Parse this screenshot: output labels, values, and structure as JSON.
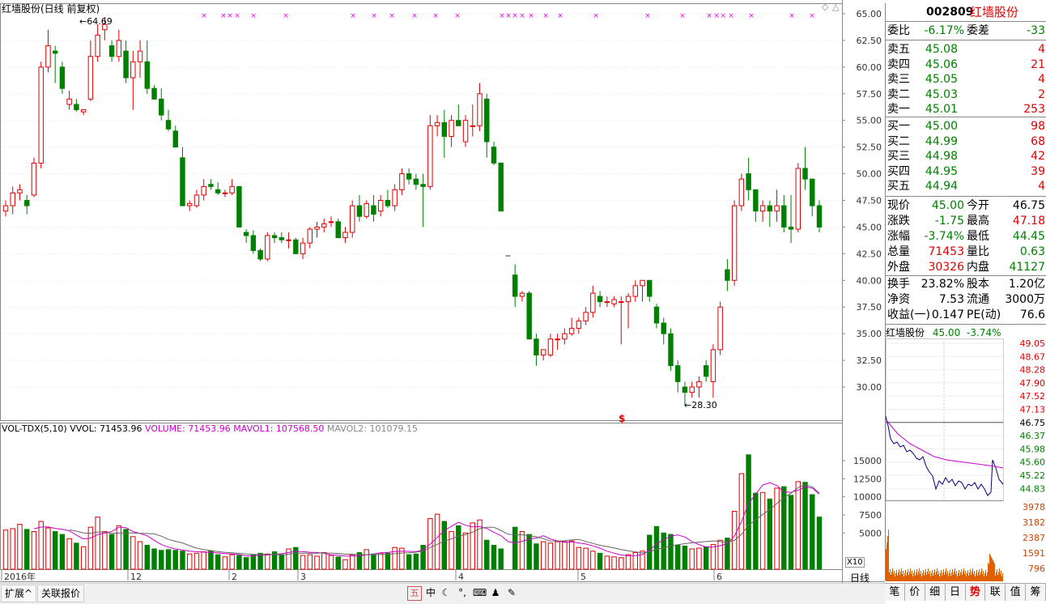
{
  "main_chart": {
    "title": "红墙股份(日线 前复权)",
    "high_marker": "64.69",
    "low_marker": "28.30",
    "y_ticks": [
      "65.00",
      "62.50",
      "60.00",
      "57.50",
      "55.00",
      "52.50",
      "50.00",
      "47.50",
      "45.00",
      "42.50",
      "40.00",
      "37.50",
      "35.00",
      "32.50",
      "30.00"
    ],
    "period_button": "日线"
  },
  "volume_chart": {
    "legend_name": "VOL-TDX(5,10)",
    "vvol": "VVOL: 71453.96",
    "volume": "VOLUME: 71453.96",
    "mavol1": "MAVOL1: 107568.50",
    "mavol2": "MAVOL2: 101079.15",
    "y_ticks": [
      "15000",
      "12500",
      "10000",
      "7500",
      "5000"
    ],
    "scale_label": "X10"
  },
  "x_axis": {
    "labels": [
      "2016年",
      "12",
      "2",
      "3",
      "4",
      "5",
      "6"
    ]
  },
  "quote": {
    "code": "002809",
    "name": "红墙股份",
    "weibi_label": "委比",
    "weibi": "-6.17%",
    "weicha_label": "委差",
    "weicha": "-33",
    "asks": [
      {
        "label": "卖五",
        "price": "45.08",
        "vol": "4"
      },
      {
        "label": "卖四",
        "price": "45.06",
        "vol": "21"
      },
      {
        "label": "卖三",
        "price": "45.05",
        "vol": "4"
      },
      {
        "label": "卖二",
        "price": "45.03",
        "vol": "2"
      },
      {
        "label": "卖一",
        "price": "45.01",
        "vol": "253"
      }
    ],
    "bids": [
      {
        "label": "买一",
        "price": "45.00",
        "vol": "98"
      },
      {
        "label": "买二",
        "price": "44.99",
        "vol": "68"
      },
      {
        "label": "买三",
        "price": "44.98",
        "vol": "42"
      },
      {
        "label": "买四",
        "price": "44.95",
        "vol": "39"
      },
      {
        "label": "买五",
        "price": "44.94",
        "vol": "4"
      }
    ],
    "stats": [
      {
        "l1": "现价",
        "v1": "45.00",
        "c1": "green",
        "l2": "今开",
        "v2": "46.75",
        "c2": "blk"
      },
      {
        "l1": "涨跌",
        "v1": "-1.75",
        "c1": "green",
        "l2": "最高",
        "v2": "47.18",
        "c2": "red"
      },
      {
        "l1": "涨幅",
        "v1": "-3.74%",
        "c1": "green",
        "l2": "最低",
        "v2": "44.45",
        "c2": "green"
      },
      {
        "l1": "总量",
        "v1": "71453",
        "c1": "red",
        "l2": "量比",
        "v2": "0.63",
        "c2": "green"
      },
      {
        "l1": "外盘",
        "v1": "30326",
        "c1": "red",
        "l2": "内盘",
        "v2": "41127",
        "c2": "green"
      }
    ],
    "stats2": [
      {
        "l1": "换手",
        "v1": "23.82%",
        "l2": "股本",
        "v2": "1.20亿"
      },
      {
        "l1": "净资",
        "v1": "7.53",
        "l2": "流通",
        "v2": "3000万"
      },
      {
        "l1": "收益(一)",
        "v1": "0.147",
        "l2": "PE(动)",
        "v2": "76.6"
      }
    ]
  },
  "mini_chart": {
    "title": "红墙股份",
    "price": "45.00",
    "pct": "-3.74%",
    "price_ticks": [
      "49.05",
      "48.67",
      "48.28",
      "47.90",
      "47.52",
      "47.13",
      "46.75",
      "46.37",
      "45.98",
      "45.60",
      "45.22",
      "44.83"
    ],
    "vol_ticks": [
      "3978",
      "3182",
      "2387",
      "1591",
      "796"
    ]
  },
  "bottom_tabs": [
    "笔",
    "价",
    "细",
    "日",
    "势",
    "联",
    "值",
    "筹"
  ],
  "active_tab": "势",
  "bottom_bar": {
    "expand_btn": "扩展^",
    "related_btn": "关联报价",
    "tools": [
      "五",
      "中"
    ]
  },
  "colors": {
    "up": "#e00000",
    "down": "#008000",
    "ma1": "#cc00cc",
    "ma2": "#666666",
    "mark": "#ff00ff"
  },
  "chart_data": {
    "type": "candlestick",
    "ylim": [
      27,
      66
    ],
    "candles": [
      [
        46.5,
        47.5,
        46.0,
        47.0
      ],
      [
        47.0,
        48.8,
        46.2,
        48.2
      ],
      [
        48.2,
        49.0,
        47.5,
        48.5
      ],
      [
        47.5,
        48.0,
        46.2,
        47.0
      ],
      [
        48.0,
        51.5,
        47.8,
        51.0
      ],
      [
        51.0,
        60.5,
        50.5,
        60.0
      ],
      [
        60.0,
        63.5,
        59.5,
        62.0
      ],
      [
        61.5,
        62.0,
        58.5,
        61.3
      ],
      [
        60.0,
        60.5,
        57.5,
        58.0
      ],
      [
        56.5,
        57.8,
        56.0,
        57.0
      ],
      [
        56.5,
        57.0,
        55.8,
        56.0
      ],
      [
        55.8,
        56.0,
        55.5,
        56.0
      ],
      [
        57.0,
        62.5,
        56.8,
        61.0
      ],
      [
        61.0,
        64.0,
        60.5,
        63.0
      ],
      [
        63.5,
        64.69,
        62.5,
        64.0
      ],
      [
        62.0,
        62.5,
        60.5,
        61.0
      ],
      [
        61.0,
        63.5,
        60.5,
        62.5
      ],
      [
        61.5,
        62.5,
        58.5,
        59.0
      ],
      [
        59.0,
        61.5,
        56.0,
        60.5
      ],
      [
        60.5,
        62.5,
        59.0,
        61.5
      ],
      [
        60.5,
        62.5,
        57.5,
        58.0
      ],
      [
        58.0,
        58.3,
        57.5,
        57.0
      ],
      [
        57.0,
        58.0,
        55.0,
        55.5
      ],
      [
        55.0,
        56.0,
        54.0,
        54.2
      ],
      [
        54.0,
        54.5,
        52.5,
        52.5
      ],
      [
        51.5,
        52.5,
        47.0,
        47.0
      ],
      [
        47.0,
        47.5,
        46.5,
        47.2
      ],
      [
        47.0,
        48.5,
        46.8,
        48.0
      ],
      [
        48.0,
        49.5,
        47.5,
        48.8
      ],
      [
        49.0,
        49.5,
        48.5,
        48.8
      ],
      [
        48.5,
        49.2,
        48.0,
        48.2
      ],
      [
        48.2,
        48.5,
        47.8,
        48.2
      ],
      [
        48.2,
        49.5,
        48.0,
        48.8
      ],
      [
        48.8,
        48.8,
        45.0,
        45.0
      ],
      [
        44.5,
        44.8,
        43.5,
        44.2
      ],
      [
        44.2,
        44.7,
        42.5,
        42.8
      ],
      [
        42.8,
        43.0,
        41.8,
        42.0
      ],
      [
        42.0,
        44.5,
        41.8,
        44.2
      ],
      [
        44.2,
        44.5,
        43.5,
        44.0
      ],
      [
        44.0,
        44.5,
        43.5,
        43.8
      ],
      [
        43.8,
        44.5,
        43.0,
        43.8
      ],
      [
        43.8,
        44.0,
        42.5,
        42.5
      ],
      [
        42.5,
        44.0,
        42.0,
        43.5
      ],
      [
        43.5,
        45.0,
        43.0,
        44.8
      ],
      [
        44.8,
        45.5,
        44.0,
        45.0
      ],
      [
        45.0,
        45.8,
        44.5,
        45.3
      ],
      [
        45.5,
        46.0,
        45.0,
        45.5
      ],
      [
        45.5,
        45.8,
        44.0,
        44.0
      ],
      [
        44.0,
        45.0,
        43.5,
        44.5
      ],
      [
        44.5,
        47.5,
        44.0,
        47.0
      ],
      [
        47.0,
        48.0,
        45.5,
        46.0
      ],
      [
        46.0,
        47.5,
        45.8,
        47.2
      ],
      [
        47.0,
        48.0,
        45.5,
        46.2
      ],
      [
        46.5,
        48.0,
        46.0,
        47.5
      ],
      [
        47.5,
        48.5,
        46.8,
        47.0
      ],
      [
        47.0,
        49.0,
        46.5,
        48.5
      ],
      [
        48.5,
        50.5,
        48.0,
        50.0
      ],
      [
        50.0,
        50.5,
        49.0,
        49.5
      ],
      [
        49.5,
        50.0,
        48.5,
        49.0
      ],
      [
        49.0,
        50.0,
        45.0,
        48.8
      ],
      [
        48.8,
        55.5,
        48.5,
        54.5
      ],
      [
        54.5,
        55.5,
        53.5,
        54.8
      ],
      [
        54.8,
        56.0,
        51.5,
        53.5
      ],
      [
        53.5,
        55.5,
        52.5,
        55.0
      ],
      [
        55.0,
        56.5,
        54.5,
        54.5
      ],
      [
        53.0,
        55.5,
        52.5,
        55.0
      ],
      [
        54.5,
        56.5,
        53.5,
        54.5
      ],
      [
        54.5,
        58.5,
        54.0,
        57.5
      ],
      [
        57.0,
        57.5,
        51.5,
        53.0
      ],
      [
        52.5,
        53.0,
        50.8,
        51.0
      ],
      [
        51.0,
        51.0,
        46.5,
        46.5
      ],
      [
        null,
        null,
        null,
        null
      ],
      [
        40.5,
        41.5,
        37.5,
        38.5
      ],
      [
        38.5,
        39.0,
        38.0,
        38.8
      ],
      [
        38.8,
        39.0,
        34.5,
        34.5
      ],
      [
        34.5,
        35.0,
        32.0,
        33.0
      ],
      [
        33.0,
        33.5,
        32.5,
        33.5
      ],
      [
        33.0,
        35.0,
        32.8,
        34.5
      ],
      [
        34.5,
        35.0,
        33.5,
        34.5
      ],
      [
        34.5,
        35.5,
        34.0,
        35.0
      ],
      [
        35.0,
        36.5,
        34.8,
        35.5
      ],
      [
        35.5,
        36.5,
        35.0,
        36.2
      ],
      [
        36.2,
        37.5,
        35.8,
        37.0
      ],
      [
        37.0,
        39.5,
        36.5,
        38.8
      ],
      [
        38.5,
        39.0,
        37.5,
        38.0
      ],
      [
        38.0,
        38.5,
        37.5,
        38.0
      ],
      [
        37.8,
        38.5,
        37.5,
        38.2
      ],
      [
        38.0,
        38.5,
        34.0,
        38.0
      ],
      [
        38.0,
        38.8,
        35.5,
        38.5
      ],
      [
        38.5,
        40.0,
        38.0,
        39.5
      ],
      [
        39.5,
        40.0,
        38.0,
        40.0
      ],
      [
        40.0,
        40.0,
        38.0,
        38.5
      ],
      [
        37.5,
        37.8,
        35.5,
        36.0
      ],
      [
        36.0,
        36.5,
        34.0,
        35.0
      ],
      [
        35.0,
        35.5,
        31.5,
        32.0
      ],
      [
        32.0,
        32.5,
        29.5,
        30.5
      ],
      [
        30.0,
        30.5,
        28.3,
        29.5
      ],
      [
        29.5,
        30.5,
        29.0,
        30.0
      ],
      [
        30.0,
        31.0,
        29.0,
        30.5
      ],
      [
        32.0,
        32.5,
        30.5,
        31.0
      ],
      [
        30.5,
        34.0,
        29.0,
        33.5
      ],
      [
        33.5,
        38.0,
        33.0,
        37.5
      ],
      [
        41.0,
        42.0,
        39.0,
        40.0
      ],
      [
        40.0,
        47.5,
        39.5,
        47.0
      ],
      [
        47.0,
        50.0,
        46.5,
        49.5
      ],
      [
        50.0,
        51.5,
        47.5,
        48.5
      ],
      [
        48.5,
        48.5,
        45.5,
        46.5
      ],
      [
        46.5,
        47.5,
        45.5,
        47.0
      ],
      [
        47.0,
        47.5,
        45.0,
        46.5
      ],
      [
        46.5,
        48.5,
        45.5,
        47.0
      ],
      [
        47.0,
        48.0,
        44.5,
        45.0
      ],
      [
        45.0,
        48.0,
        43.5,
        44.8
      ],
      [
        44.8,
        51.0,
        44.5,
        50.5
      ],
      [
        50.5,
        52.5,
        48.5,
        49.5
      ],
      [
        49.5,
        49.5,
        46.0,
        47.0
      ],
      [
        47.0,
        47.5,
        44.5,
        45.0
      ]
    ],
    "volumes": [
      540,
      560,
      620,
      550,
      520,
      660,
      570,
      520,
      480,
      420,
      360,
      310,
      580,
      720,
      520,
      480,
      600,
      550,
      450,
      380,
      330,
      280,
      260,
      270,
      260,
      250,
      210,
      220,
      240,
      250,
      200,
      170,
      200,
      190,
      160,
      200,
      220,
      210,
      240,
      200,
      280,
      300,
      190,
      200,
      180,
      230,
      190,
      170,
      130,
      200,
      230,
      270,
      210,
      220,
      220,
      300,
      290,
      200,
      210,
      330,
      700,
      760,
      660,
      520,
      600,
      500,
      640,
      680,
      400,
      330,
      280,
      220,
      580,
      520,
      480,
      350,
      380,
      360,
      380,
      380,
      390,
      300,
      290,
      250,
      220,
      180,
      170,
      160,
      200,
      230,
      250,
      470,
      590,
      500,
      480,
      330,
      320,
      280,
      290,
      310,
      340,
      400,
      430,
      800,
      1320,
      1580,
      1050,
      1060,
      970,
      1120,
      1140,
      1020,
      1210,
      1200,
      1030,
      720
    ]
  }
}
